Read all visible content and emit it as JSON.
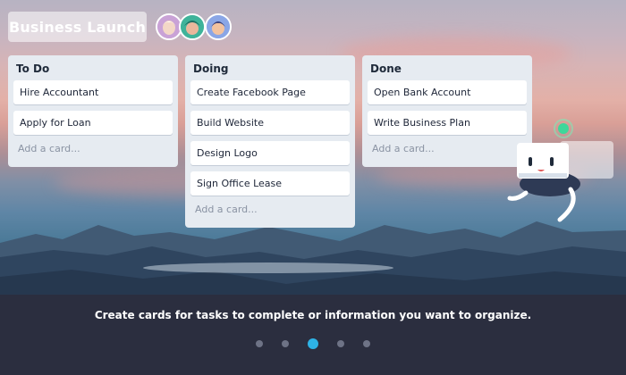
{
  "board": {
    "title": "Business Launch",
    "members": [
      {
        "name": "member-1",
        "color": "#c9a2d6"
      },
      {
        "name": "member-2",
        "color": "#3fb39a"
      },
      {
        "name": "member-3",
        "color": "#8aa6e6"
      }
    ]
  },
  "lists": [
    {
      "title": "To Do",
      "cards": [
        "Hire Accountant",
        "Apply for Loan"
      ],
      "add_card": "Add a card..."
    },
    {
      "title": "Doing",
      "cards": [
        "Create Facebook Page",
        "Build Website",
        "Design Logo",
        "Sign Office Lease"
      ],
      "add_card": "Add a card..."
    },
    {
      "title": "Done",
      "cards": [
        "Open Bank Account",
        "Write Business Plan"
      ],
      "add_card": "Add a card..."
    }
  ],
  "footer": {
    "caption": "Create cards for tasks to complete or information you want to organize.",
    "slides_total": 5,
    "active_slide": 3
  },
  "colors": {
    "accent": "#2eb3e6",
    "footer_bg": "#2b2e3f",
    "list_bg": "#e6ebf1"
  }
}
